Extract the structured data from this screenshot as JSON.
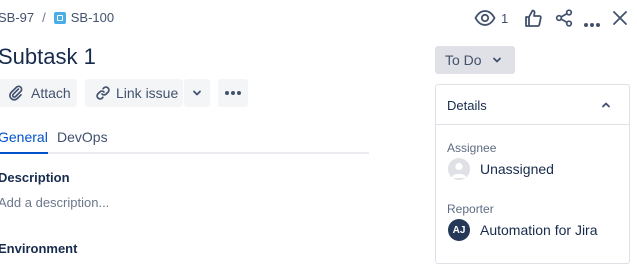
{
  "breadcrumb": {
    "parent": "SB-97",
    "separator": "/",
    "current": "SB-100"
  },
  "issue": {
    "title": "Subtask 1"
  },
  "toolbar": {
    "attach_label": "Attach",
    "link_issue_label": "Link issue"
  },
  "tabs": [
    {
      "label": "General",
      "active": true
    },
    {
      "label": "DevOps",
      "active": false
    }
  ],
  "description": {
    "label": "Description",
    "placeholder": "Add a description..."
  },
  "environment": {
    "label": "Environment"
  },
  "header_actions": {
    "watchers_count": "1"
  },
  "status": {
    "label": "To Do"
  },
  "details": {
    "title": "Details",
    "assignee": {
      "label": "Assignee",
      "value": "Unassigned"
    },
    "reporter": {
      "label": "Reporter",
      "value": "Automation for Jira",
      "initials": "AJ"
    }
  },
  "colors": {
    "accent": "#0052cc",
    "button_bg": "#f4f5f7",
    "status_bg": "#dfe1e6",
    "text": "#172b4d",
    "subtle": "#42526e",
    "reporter_avatar": "#253858",
    "issue_type_icon": "#4bade8"
  }
}
